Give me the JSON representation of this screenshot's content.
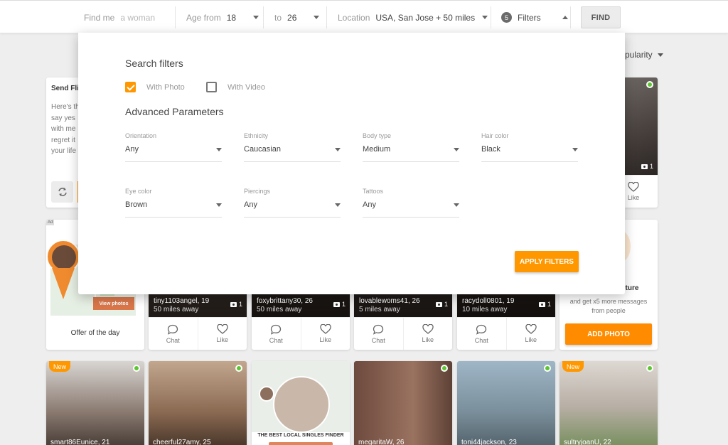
{
  "search": {
    "find_me_label": "Find me",
    "find_me_placeholder": "a woman",
    "age_from_label": "Age from",
    "age_from_value": "18",
    "age_to_label": "to",
    "age_to_value": "26",
    "location_label": "Location",
    "location_value": "USA, San Jose + 50 miles",
    "filters_count": "5",
    "filters_label": "Filters",
    "find_label": "FIND"
  },
  "sort": {
    "label": "pularity"
  },
  "panel": {
    "title": "Search filters",
    "with_photo": {
      "label": "With Photo",
      "checked": true
    },
    "with_video": {
      "label": "With Video",
      "checked": false
    },
    "advanced_title": "Advanced Parameters",
    "fields": [
      {
        "label": "Orientation",
        "value": "Any"
      },
      {
        "label": "Ethnicity",
        "value": "Caucasian"
      },
      {
        "label": "Body type",
        "value": "Medium"
      },
      {
        "label": "Hair color",
        "value": "Black"
      },
      {
        "label": "Eye color",
        "value": "Brown"
      },
      {
        "label": "Piercings",
        "value": "Any"
      },
      {
        "label": "Tattoos",
        "value": "Any"
      }
    ],
    "apply_label": "APPLY FILTERS"
  },
  "flirt_card": {
    "title": "Send Fli",
    "lines": [
      "Here's th",
      "say yes",
      "with me",
      "regret it",
      "your life"
    ]
  },
  "top_right_card": {
    "photo_count": "1",
    "like_label": "Like"
  },
  "ad_card": {
    "ad": "Ad",
    "view_photos": "View photos",
    "caption": "Offer of the day"
  },
  "row2_profiles": [
    {
      "name": "tiny1103angel",
      "age": "19",
      "distance": "50 miles away",
      "photos": "1",
      "chat": "Chat",
      "like": "Like"
    },
    {
      "name": "foxybrittany30",
      "age": "26",
      "distance": "50 miles away",
      "photos": "1",
      "chat": "Chat",
      "like": "Like"
    },
    {
      "name": "lovablewoms41",
      "age": "26",
      "distance": "5 miles away",
      "photos": "1",
      "chat": "Chat",
      "like": "Like"
    },
    {
      "name": "racydoll0801",
      "age": "19",
      "distance": "10 miles away",
      "photos": "1",
      "chat": "Chat",
      "like": "Like"
    }
  ],
  "upload_card": {
    "title": "cture",
    "text1": "and get x5 more messages",
    "text2": "from people",
    "button": "ADD PHOTO"
  },
  "row3": {
    "new_tag": "New",
    "ad": "Ad",
    "ad_caption": "THE BEST LOCAL SINGLES FINDER",
    "names": [
      "smart86Eunice, 21",
      "cheerful27amy, 25",
      "megaritaW, 26",
      "toni44jackson, 23",
      "sultryjoanU, 22"
    ]
  }
}
